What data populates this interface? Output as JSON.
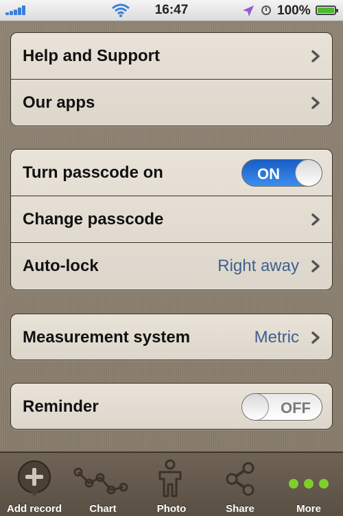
{
  "status_bar": {
    "time": "16:47",
    "battery_percent": "100%",
    "signal_bars": 5,
    "icons": [
      "signal-icon",
      "wifi-icon",
      "location-arrow-icon",
      "alarm-clock-icon",
      "battery-icon"
    ]
  },
  "groups": {
    "support": {
      "help_label": "Help and Support",
      "apps_label": "Our apps"
    },
    "security": {
      "passcode_label": "Turn passcode on",
      "passcode_toggle": "ON",
      "change_passcode_label": "Change passcode",
      "autolock_label": "Auto-lock",
      "autolock_value": "Right away"
    },
    "units": {
      "measurement_label": "Measurement system",
      "measurement_value": "Metric"
    },
    "reminder": {
      "reminder_label": "Reminder",
      "reminder_toggle": "OFF"
    }
  },
  "tab_bar": {
    "tabs": [
      {
        "label": "Add record",
        "icon": "add-record-icon"
      },
      {
        "label": "Chart",
        "icon": "chart-icon"
      },
      {
        "label": "Photo",
        "icon": "photo-person-icon"
      },
      {
        "label": "Share",
        "icon": "share-icon"
      },
      {
        "label": "More",
        "icon": "more-dots-icon"
      }
    ]
  },
  "colors": {
    "toggle_on": "#2a7ae2",
    "value_text": "#3f5f8e",
    "more_dots": "#7ecf2a",
    "background": "#8a7e6e"
  }
}
